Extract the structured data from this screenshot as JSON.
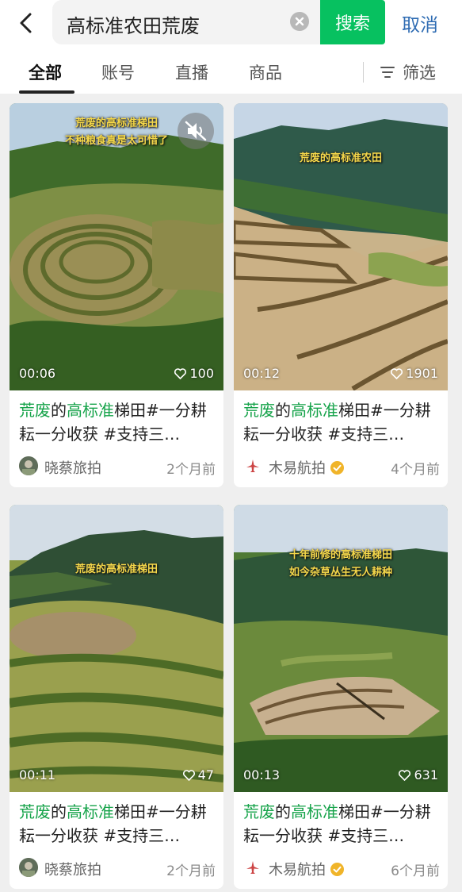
{
  "header": {
    "search_query": "高标准农田荒废",
    "search_button": "搜索",
    "cancel_button": "取消"
  },
  "tabs": [
    {
      "label": "全部",
      "active": true
    },
    {
      "label": "账号",
      "active": false
    },
    {
      "label": "直播",
      "active": false
    },
    {
      "label": "商品",
      "active": false
    }
  ],
  "filter_label": "筛选",
  "accent_color": "#07c160",
  "highlight_color": "#16a34a",
  "cards": [
    {
      "overlay": [
        "荒废的高标准梯田",
        "不种粮食真是太可惜了"
      ],
      "duration": "00:06",
      "likes": "100",
      "title_parts": [
        "荒废",
        "的",
        "高标准",
        "梯田#一分耕耘一分收获 #支持三…"
      ],
      "author": "晓蔡旅拍",
      "verified": false,
      "time": "2个月前",
      "muted": true
    },
    {
      "overlay": [
        "荒废的高标准农田"
      ],
      "duration": "00:12",
      "likes": "1901",
      "title_parts": [
        "荒废",
        "的",
        "高标准",
        "梯田#一分耕耘一分收获 #支持三…"
      ],
      "author": "木易航拍",
      "verified": true,
      "time": "4个月前",
      "muted": false
    },
    {
      "overlay": [
        "荒废的高标准梯田"
      ],
      "duration": "00:11",
      "likes": "47",
      "title_parts": [
        "荒废",
        "的",
        "高标准",
        "梯田#一分耕耘一分收获 #支持三…"
      ],
      "author": "晓蔡旅拍",
      "verified": false,
      "time": "2个月前",
      "muted": false
    },
    {
      "overlay": [
        "十年前修的高标准梯田",
        "如今杂草丛生无人耕种"
      ],
      "duration": "00:13",
      "likes": "631",
      "title_parts": [
        "荒废",
        "的",
        "高标准",
        "梯田#一分耕耘一分收获 #支持三…"
      ],
      "author": "木易航拍",
      "verified": true,
      "time": "6个月前",
      "muted": false
    }
  ]
}
